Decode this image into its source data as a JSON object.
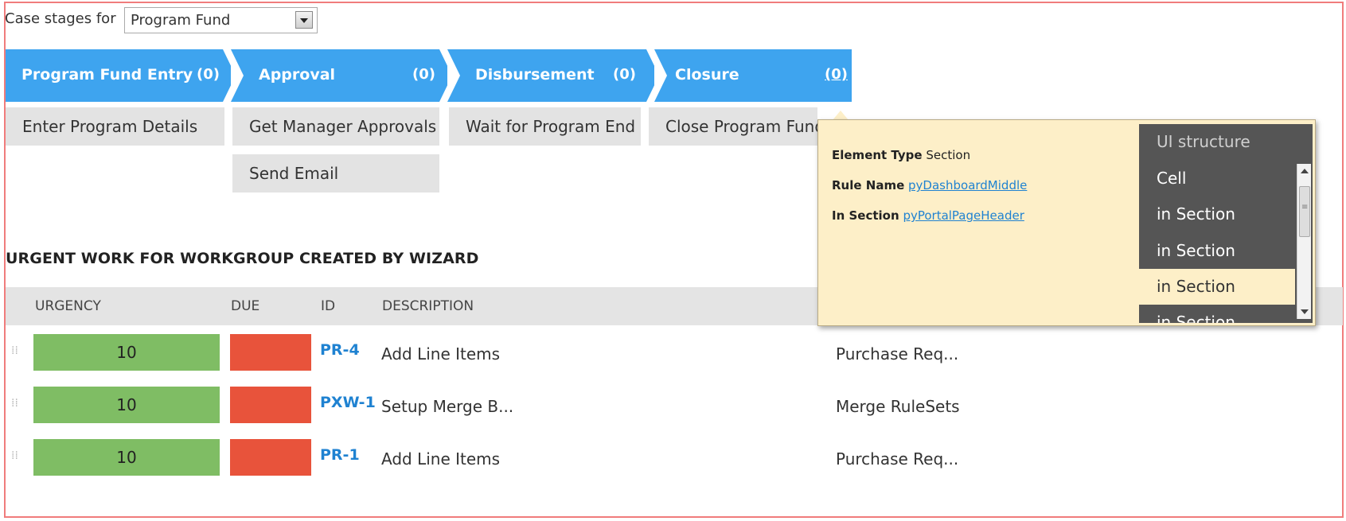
{
  "case_stages": {
    "label": "Case stages for",
    "selected": "Program Fund"
  },
  "stages": [
    {
      "label": "Program Fund Entry",
      "count": "(0)"
    },
    {
      "label": "Approval",
      "count": "(0)"
    },
    {
      "label": "Disbursement",
      "count": "(0)"
    },
    {
      "label": "Closure",
      "count": "(0)"
    }
  ],
  "steps": {
    "entry": "Enter Program Details",
    "approval_1": "Get Manager Approvals",
    "approval_2": "Send Email",
    "disbursement": "Wait for Program End",
    "closure": "Close Program Fund"
  },
  "worklist": {
    "heading": "URGENT WORK FOR WORKGROUP CREATED BY WIZARD",
    "columns": [
      "URGENCY",
      "DUE",
      "ID",
      "DESCRIPTION"
    ],
    "rows": [
      {
        "urgency": "10",
        "id": "PR-4",
        "description": "Add Line Items",
        "case_type": "Purchase Req..."
      },
      {
        "urgency": "10",
        "id": "PXW-1",
        "description": "Setup Merge B...",
        "case_type": "Merge RuleSets"
      },
      {
        "urgency": "10",
        "id": "PR-1",
        "description": "Add Line Items",
        "case_type": "Purchase Req..."
      }
    ]
  },
  "inspector": {
    "element_type_label": "Element Type",
    "element_type_value": "Section",
    "rule_name_label": "Rule Name",
    "rule_name_value": "pyDashboardMiddle",
    "in_section_label": "In Section",
    "in_section_value": "pyPortalPageHeader",
    "structure": {
      "title": "UI structure",
      "items": [
        "Cell",
        "in Section",
        "in Section",
        "in Section",
        "in Section"
      ]
    }
  },
  "colors": {
    "stage_blue": "#3ea4ef",
    "urgency_green": "#7fbd64",
    "due_red": "#e8533b",
    "popup_bg": "#fdefc8",
    "link_blue": "#1f82d1"
  }
}
